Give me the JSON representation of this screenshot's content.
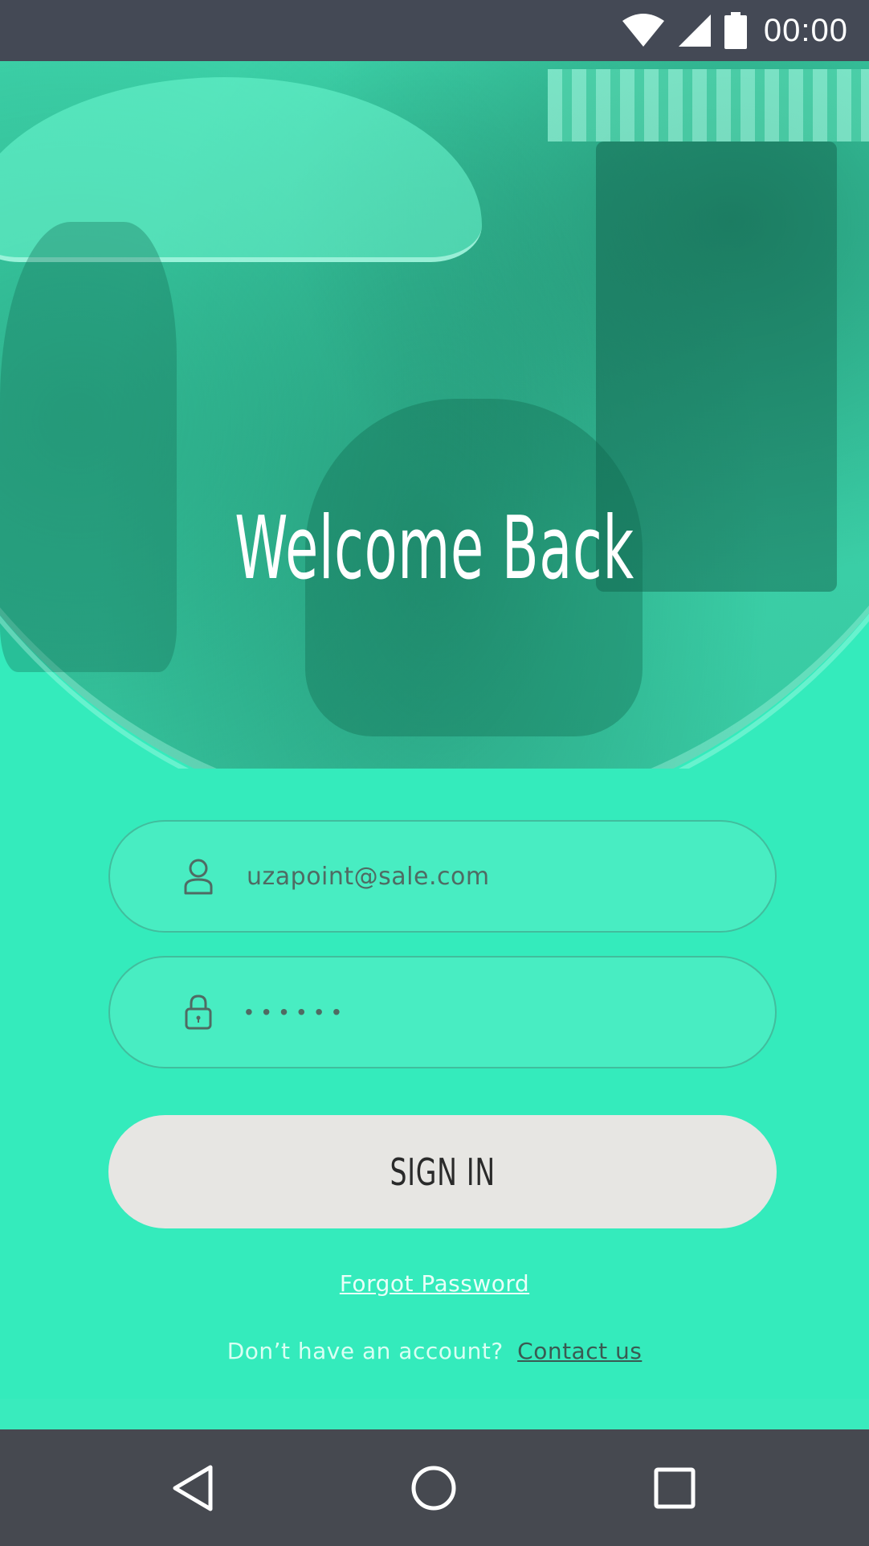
{
  "status_bar": {
    "time": "00:00",
    "wifi_icon": "wifi-icon",
    "signal_icon": "cell-signal-icon",
    "battery_icon": "battery-icon"
  },
  "hero": {
    "title": "Welcome Back"
  },
  "form": {
    "email": {
      "icon": "user-icon",
      "value": "uzapoint@sale.com"
    },
    "password": {
      "icon": "lock-icon",
      "value": "••••••"
    },
    "sign_in_label": "SIGN IN",
    "forgot_label": "Forgot Password",
    "signup_prompt": "Don’t have an account?",
    "contact_label": "Contact us"
  },
  "nav_bar": {
    "back_icon": "back-triangle-icon",
    "home_icon": "home-circle-icon",
    "recent_icon": "recent-apps-square-icon"
  },
  "colors": {
    "accent": "#34ebbc",
    "status_bar": "#444955",
    "nav_bar": "#464950",
    "button_bg": "#e7e6e3"
  }
}
